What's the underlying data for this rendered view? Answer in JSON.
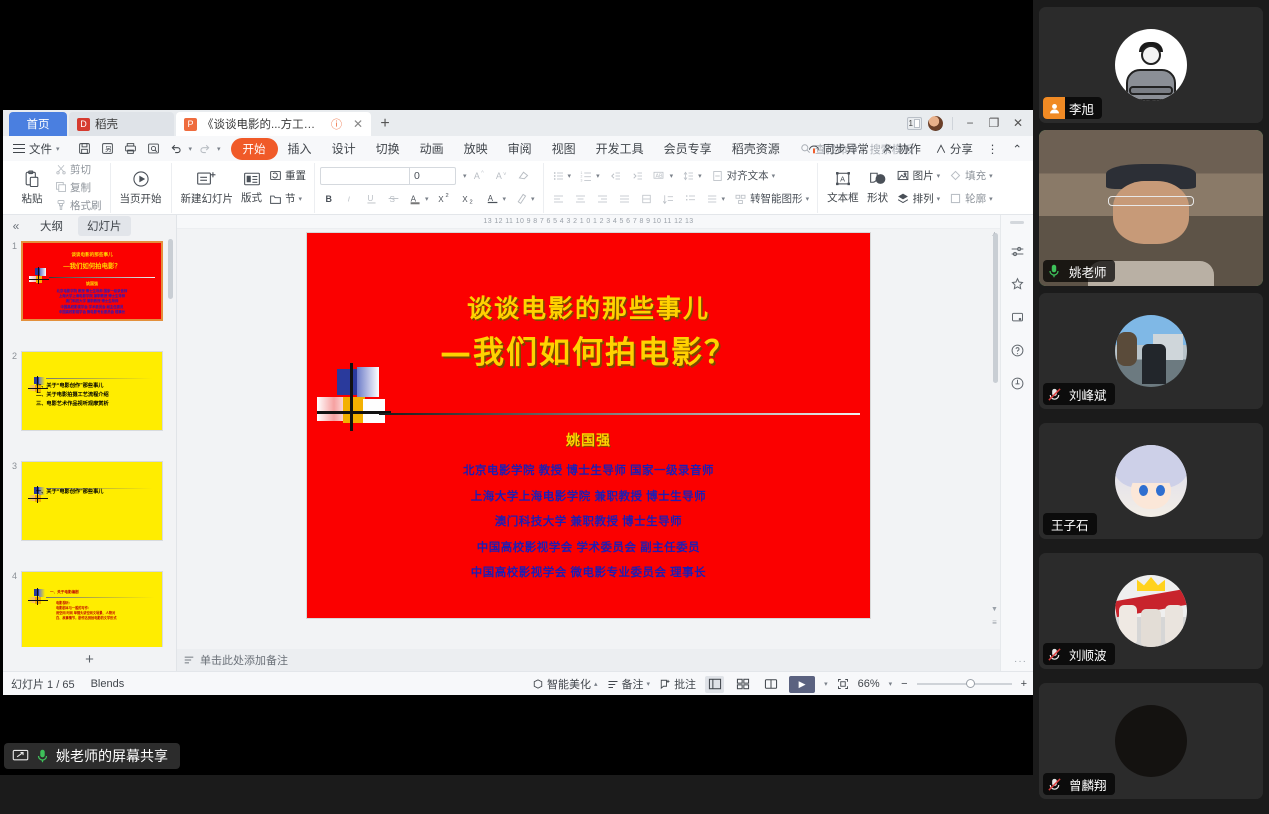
{
  "app": {
    "tabs": [
      {
        "label": "首页",
        "icon": "home-icon"
      },
      {
        "label": "稻壳",
        "icon": "docer-icon"
      },
      {
        "label": "《谈谈电影的...方工业大学)",
        "icon": "ppt-icon"
      }
    ],
    "new_tab": "+",
    "window": {
      "page_indicator": "1",
      "minimize": "−",
      "maximize": "❐",
      "close": "✕"
    }
  },
  "menu": {
    "file": "文件",
    "quick_access": [
      "save-icon",
      "save-as-icon",
      "print-icon",
      "print-preview-icon",
      "undo-icon",
      "redo-icon",
      "customize-icon"
    ],
    "ribbon_tabs": [
      "开始",
      "插入",
      "设计",
      "切换",
      "动画",
      "放映",
      "审阅",
      "视图",
      "开发工具",
      "会员专享",
      "稻壳资源"
    ],
    "active_ribbon_tab": "开始",
    "search_placeholder": "查找命令、搜索模板",
    "right_items": [
      {
        "label": "同步异常",
        "icon": "sync-warning-icon"
      },
      {
        "label": "协作",
        "icon": "collaborate-icon"
      },
      {
        "label": "分享",
        "icon": "share-icon"
      }
    ],
    "more": "⋮",
    "collapse": "⌃"
  },
  "ribbon": {
    "groups": [
      {
        "name": "clipboard",
        "big": {
          "label": "粘贴",
          "icon": "paste-icon"
        },
        "small": [
          {
            "label": "剪切",
            "icon": "cut-icon"
          },
          {
            "label": "复制",
            "icon": "copy-icon"
          },
          {
            "label": "格式刷",
            "icon": "format-painter-icon"
          }
        ]
      },
      {
        "name": "start-show",
        "big": {
          "label": "当页开始",
          "icon": "play-circle-icon"
        }
      },
      {
        "name": "slides",
        "big": {
          "label": "新建幻灯片",
          "icon": "new-slide-icon"
        },
        "small": [
          {
            "label": "版式",
            "icon": "layout-icon"
          },
          {
            "label": "重置",
            "icon": "reset-icon"
          },
          {
            "label": "节",
            "icon": "section-icon"
          }
        ]
      },
      {
        "name": "font",
        "font_name": "",
        "font_size": "0",
        "buttons": [
          {
            "label": "A",
            "icon": "increase-font-icon"
          },
          {
            "label": "A",
            "icon": "decrease-font-icon"
          },
          {
            "label": "",
            "icon": "clear-format-icon"
          },
          {
            "label": "B",
            "icon": "bold-icon"
          },
          {
            "label": "I",
            "icon": "italic-icon"
          },
          {
            "label": "U",
            "icon": "underline-icon"
          },
          {
            "label": "S",
            "icon": "strikethrough-icon"
          },
          {
            "label": "A",
            "icon": "text-color-icon"
          },
          {
            "label": "X²",
            "icon": "superscript-icon"
          },
          {
            "label": "X₂",
            "icon": "subscript-icon"
          },
          {
            "label": "",
            "icon": "text-effects-icon"
          },
          {
            "label": "",
            "icon": "highlight-icon"
          }
        ]
      },
      {
        "name": "paragraph",
        "small": [
          {
            "label": "",
            "icon": "bullets-icon"
          },
          {
            "label": "",
            "icon": "numbering-icon"
          },
          {
            "label": "",
            "icon": "decrease-indent-icon"
          },
          {
            "label": "",
            "icon": "increase-indent-icon"
          },
          {
            "label": "",
            "icon": "text-direction-icon"
          },
          {
            "label": "",
            "icon": "line-spacing-icon"
          },
          {
            "label": "",
            "icon": "align-left-icon"
          },
          {
            "label": "",
            "icon": "align-center-icon"
          },
          {
            "label": "",
            "icon": "align-right-icon"
          },
          {
            "label": "",
            "icon": "justify-icon"
          },
          {
            "label": "",
            "icon": "distribute-icon"
          },
          {
            "label": "",
            "icon": "increase-para-spacing-icon"
          },
          {
            "label": "",
            "icon": "decrease-para-spacing-icon"
          },
          {
            "label": "",
            "icon": "columns-icon"
          },
          {
            "label": "对齐文本",
            "icon": "align-text-icon"
          },
          {
            "label": "转智能图形",
            "icon": "smartart-icon"
          }
        ]
      },
      {
        "name": "insert-tools",
        "items": [
          {
            "label": "文本框",
            "icon": "textbox-icon"
          },
          {
            "label": "形状",
            "icon": "shapes-icon"
          },
          {
            "label": "图片",
            "icon": "picture-icon"
          },
          {
            "label": "排列",
            "icon": "arrange-icon"
          },
          {
            "label": "填充",
            "icon": "fill-icon"
          },
          {
            "label": "轮廓",
            "icon": "outline-icon"
          }
        ]
      }
    ]
  },
  "thumbpane": {
    "collapse": "«",
    "tab_outline": "大纲",
    "tab_slides": "幻灯片",
    "selected_tab": "幻灯片",
    "add_slide": "+",
    "slides": [
      {
        "number": "1",
        "selected": true,
        "type": "title",
        "title_line1": "谈谈电影的那些事儿",
        "title_line2": "—我们如何拍电影？",
        "author": "姚国强",
        "body": [
          "北京电影学院 教授 博士生导师 国家一级录音师",
          "上海大学上海电影学院 兼职教授 博士生导师",
          "澳门科技大学 兼职教授 博士生导师",
          "中国高校影视学会 学术委员会 副主任委员",
          "中国高校影视学会 微电影专业委员会 理事长"
        ]
      },
      {
        "number": "2",
        "selected": false,
        "type": "yellow",
        "lines": [
          "一、关于“电影创作”那些事儿",
          "二、关于电影拍摄工艺流程介绍",
          "三、电影艺术作品视听观摩赏析"
        ]
      },
      {
        "number": "3",
        "selected": false,
        "type": "yellow",
        "lines": [
          "一、关于“电影创作”那些事儿"
        ]
      },
      {
        "number": "4",
        "selected": false,
        "type": "yellow-small",
        "lines": [
          "一、关于电影编剧",
          "电影视听：",
          "电影剧本与一般的写作：",
          "用空间 时间 单镜头讲空间文场景、人物对",
          "白、故事情节，剧作达到拍电影的文学形式"
        ]
      }
    ]
  },
  "editor": {
    "ruler_marks": "13  12  11  10  9  8  7  6  5  4  3  2  1  0  1  2  3  4  5  6  7  8  9  10  11  12  13",
    "slide": {
      "title_line1": "谈谈电影的那些事儿",
      "title_line2": "—我们如何拍电影？",
      "author": "姚国强",
      "body": [
        "北京电影学院 教授 博士生导师 国家一级录音师",
        "上海大学上海电影学院 兼职教授 博士生导师",
        "澳门科技大学 兼职教授 博士生导师",
        "中国高校影视学会 学术委员会 副主任委员",
        "中国高校影视学会 微电影专业委员会 理事长"
      ],
      "background_color": "#fb0000",
      "title_color": "#ffd200",
      "body_color": "#1d1db4"
    },
    "notes_placeholder": "单击此处添加备注"
  },
  "right_strip": {
    "icons": [
      "properties-icon",
      "magic-beautify-icon",
      "screen-record-icon",
      "help-icon",
      "feedback-icon"
    ],
    "more": "···"
  },
  "status": {
    "slide_count": "幻灯片 1 / 65",
    "theme": "Blends",
    "right_items": [
      {
        "label": "智能美化",
        "icon": "beautify-icon"
      },
      {
        "label": "备注",
        "icon": "notes-icon"
      },
      {
        "label": "批注",
        "icon": "comment-icon"
      }
    ],
    "views": [
      {
        "icon": "normal-view-icon",
        "selected": true
      },
      {
        "icon": "slide-sorter-icon",
        "selected": false
      },
      {
        "icon": "reading-view-icon",
        "selected": false
      }
    ],
    "play": "▶",
    "fit_icon": "fit-to-window-icon",
    "zoom": "66%",
    "zoom_out": "−",
    "zoom_in": "+"
  },
  "participants": [
    {
      "name": "李旭",
      "mic": "muted-orange",
      "avatar": "person-illustration",
      "active": false,
      "camera_off": true
    },
    {
      "name": "姚老师",
      "mic": "unmuted-green",
      "avatar": "teacher-video",
      "active": true,
      "camera_off": false
    },
    {
      "name": "刘峰斌",
      "mic": "muted",
      "avatar": "photo-street",
      "active": false,
      "camera_off": true
    },
    {
      "name": "王子石",
      "mic": "none",
      "avatar": "anime-girl",
      "active": false,
      "camera_off": true
    },
    {
      "name": "刘顺波",
      "mic": "muted",
      "avatar": "group-photo",
      "active": false,
      "camera_off": true
    },
    {
      "name": "曾麟翔",
      "mic": "muted",
      "avatar": "dark-blank",
      "active": false,
      "camera_off": true
    }
  ],
  "share_bar": {
    "label": "姚老师的屏幕共享",
    "screen_icon": "screen-share-icon",
    "mic_icon": "mic-icon"
  },
  "colors": {
    "accent_orange": "#f05a28",
    "tab_blue": "#4a7fe0",
    "active_green": "#3ec15a",
    "mic_orange": "#f08a24",
    "slide_red": "#fb0000",
    "slide_yellow": "#ffed00"
  }
}
